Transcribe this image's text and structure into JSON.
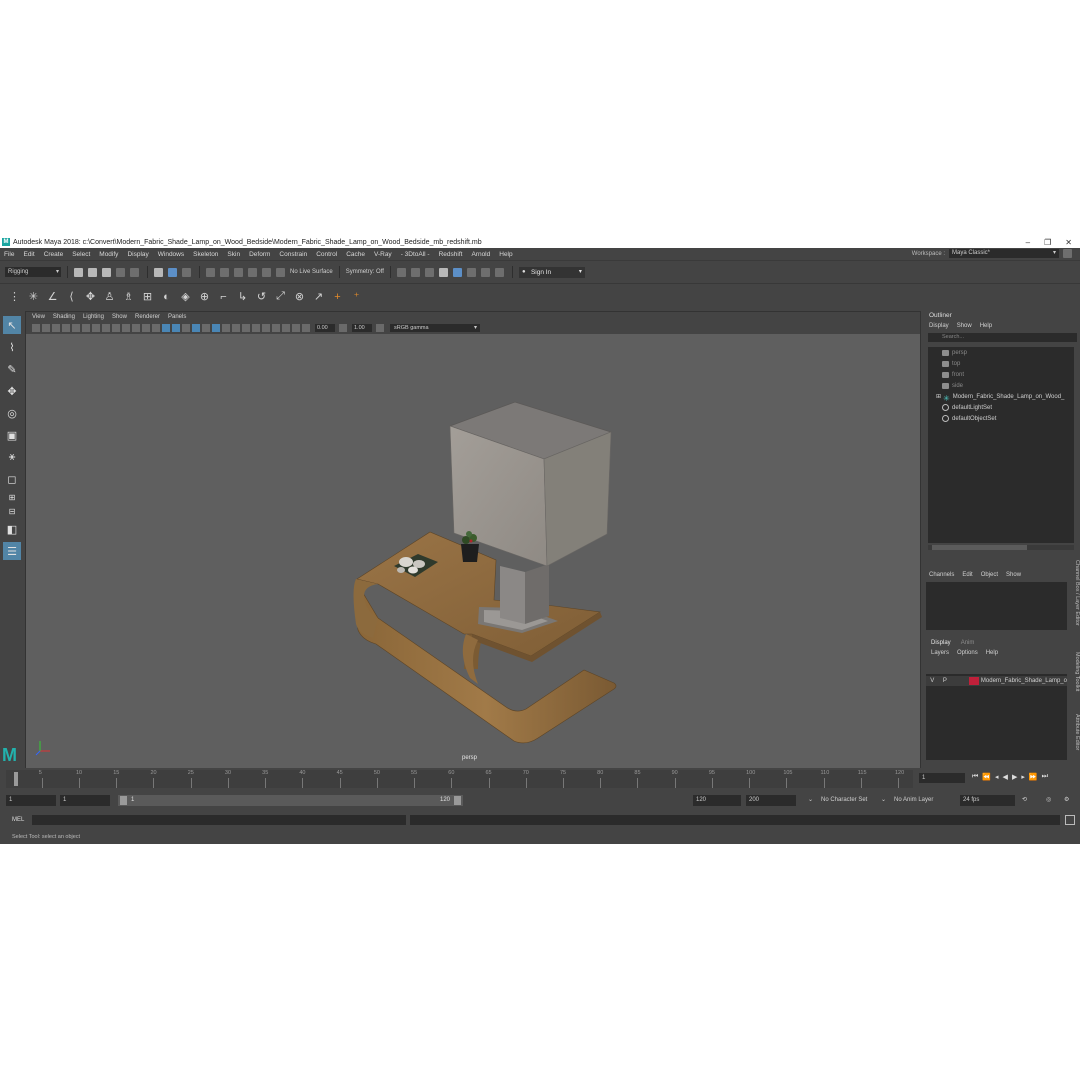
{
  "window": {
    "title": "Autodesk Maya 2018: c:\\Convert\\Modern_Fabric_Shade_Lamp_on_Wood_Bedside\\Modern_Fabric_Shade_Lamp_on_Wood_Bedside_mb_redshift.mb",
    "logo": "M"
  },
  "menubar": {
    "items": [
      "File",
      "Edit",
      "Create",
      "Select",
      "Modify",
      "Display",
      "Windows",
      "Skeleton",
      "Skin",
      "Deform",
      "Constrain",
      "Control",
      "Cache",
      "V-Ray",
      "- 3DtoAll -",
      "Redshift",
      "Arnold",
      "Help"
    ],
    "workspace_label": "Workspace :",
    "workspace_value": "Maya Classic*"
  },
  "statusline": {
    "menuset": "Rigging",
    "live_surface": "No Live Surface",
    "symmetry": "Symmetry: Off",
    "sign_in": "Sign In"
  },
  "panel": {
    "menus": [
      "View",
      "Shading",
      "Lighting",
      "Show",
      "Renderer",
      "Panels"
    ],
    "exposure": "0.00",
    "gamma_value": "1.00",
    "color_space": "sRGB gamma",
    "camera_label": "persp"
  },
  "outliner": {
    "title": "Outliner",
    "menus": [
      "Display",
      "Show",
      "Help"
    ],
    "search_placeholder": "Search...",
    "items": [
      {
        "label": "persp",
        "kind": "camera",
        "dim": true
      },
      {
        "label": "top",
        "kind": "camera",
        "dim": true
      },
      {
        "label": "front",
        "kind": "camera",
        "dim": true
      },
      {
        "label": "side",
        "kind": "camera",
        "dim": true
      },
      {
        "label": "Modern_Fabric_Shade_Lamp_on_Wood_",
        "kind": "group",
        "dim": false
      },
      {
        "label": "defaultLightSet",
        "kind": "set",
        "dim": false
      },
      {
        "label": "defaultObjectSet",
        "kind": "set",
        "dim": false
      }
    ]
  },
  "channelbox": {
    "menus": [
      "Channels",
      "Edit",
      "Object",
      "Show"
    ]
  },
  "layereditor": {
    "tabs": [
      "Display",
      "Anim"
    ],
    "menus": [
      "Layers",
      "Options",
      "Help"
    ],
    "layer": {
      "v": "V",
      "p": "P",
      "name": "Modern_Fabric_Shade_Lamp_o",
      "color": "#c0203a"
    }
  },
  "side_tabs": [
    "Channel Box / Layer Editor",
    "Modeling Toolkit",
    "Attribute Editor"
  ],
  "timeline": {
    "ticks": [
      "5",
      "10",
      "15",
      "20",
      "25",
      "30",
      "35",
      "40",
      "45",
      "50",
      "55",
      "60",
      "65",
      "70",
      "75",
      "80",
      "85",
      "90",
      "95",
      "100",
      "105",
      "110",
      "115",
      "120"
    ],
    "current_frame": "1"
  },
  "range": {
    "start": "1",
    "playback_start": "1",
    "slider_start": "1",
    "slider_end": "120",
    "playback_end": "120",
    "end": "200",
    "character_set": "No Character Set",
    "anim_layer": "No Anim Layer",
    "fps": "24 fps"
  },
  "cmdline": {
    "label": "MEL"
  },
  "helpline": {
    "text": "Select Tool: select an object"
  }
}
